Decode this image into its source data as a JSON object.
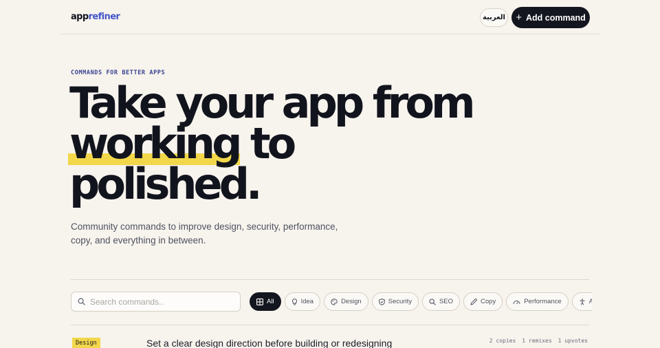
{
  "header": {
    "logo_part1": "app",
    "logo_part2": "refiner",
    "language_label": "العربية",
    "add_command_label": "Add command"
  },
  "hero": {
    "eyebrow": "COMMANDS FOR BETTER APPS",
    "headline_line1": "Take your app from",
    "headline_highlight": "working",
    "headline_line2_rest": " to",
    "headline_line3": "polished.",
    "subtitle": "Community commands to improve design, security, performance, copy, and everything in between."
  },
  "search": {
    "placeholder": "Search commands..",
    "icon": "search-icon"
  },
  "filters": [
    {
      "label": "All",
      "icon": "grid-icon",
      "active": true
    },
    {
      "label": "Idea",
      "icon": "lightbulb-icon",
      "active": false
    },
    {
      "label": "Design",
      "icon": "palette-icon",
      "active": false
    },
    {
      "label": "Security",
      "icon": "shield-icon",
      "active": false
    },
    {
      "label": "SEO",
      "icon": "search-icon",
      "active": false
    },
    {
      "label": "Copy",
      "icon": "pencil-icon",
      "active": false
    },
    {
      "label": "Performance",
      "icon": "gauge-icon",
      "active": false
    },
    {
      "label": "Accessibility",
      "icon": "accessibility-icon",
      "active": false
    }
  ],
  "commands": [
    {
      "category": "Design",
      "title": "Set a clear design direction before building or redesigning",
      "copies": "2 copies",
      "remixes": "1 remixes",
      "upvotes": "1 upvotes"
    }
  ],
  "colors": {
    "background": "#f7f3ed",
    "ink": "#14161f",
    "accent_blue": "#4356c9",
    "highlight_yellow": "#f2d74a"
  }
}
